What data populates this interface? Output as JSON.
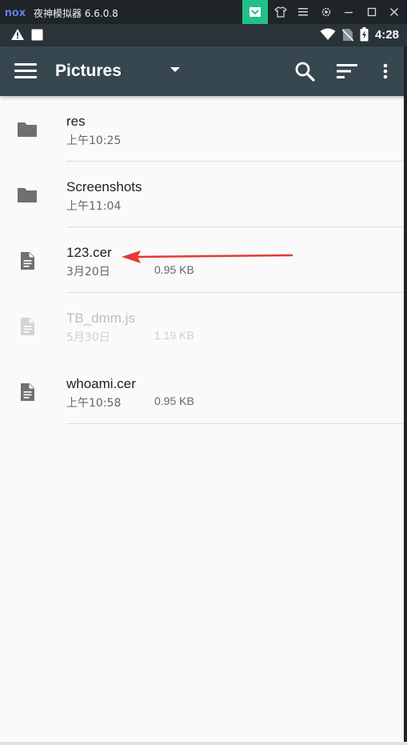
{
  "emulator": {
    "logo": "nox",
    "title": "夜神模拟器 6.6.0.8",
    "icons": [
      "keyboard-badge-icon",
      "shirt-icon",
      "menu-icon",
      "settings-icon",
      "minimize-icon",
      "maximize-icon",
      "close-icon"
    ]
  },
  "status_bar": {
    "time": "4:28"
  },
  "toolbar": {
    "title": "Pictures"
  },
  "files": [
    {
      "name": "res",
      "date": "上午10:25",
      "size": "",
      "type": "folder",
      "enabled": true
    },
    {
      "name": "Screenshots",
      "date": "上午11:04",
      "size": "",
      "type": "folder",
      "enabled": true
    },
    {
      "name": "123.cer",
      "date": "3月20日",
      "size": "0.95 KB",
      "type": "file",
      "enabled": true
    },
    {
      "name": "TB_dmm.js",
      "date": "5月30日",
      "size": "1.19 KB",
      "type": "file",
      "enabled": false
    },
    {
      "name": "whoami.cer",
      "date": "上午10:58",
      "size": "0.95 KB",
      "type": "file",
      "enabled": true
    }
  ],
  "colors": {
    "toolbar": "#37474f",
    "status_bar": "#293338",
    "emulator_bar": "#1f2428",
    "annotation_arrow": "#e53935",
    "active_icon": "#21c08b"
  }
}
